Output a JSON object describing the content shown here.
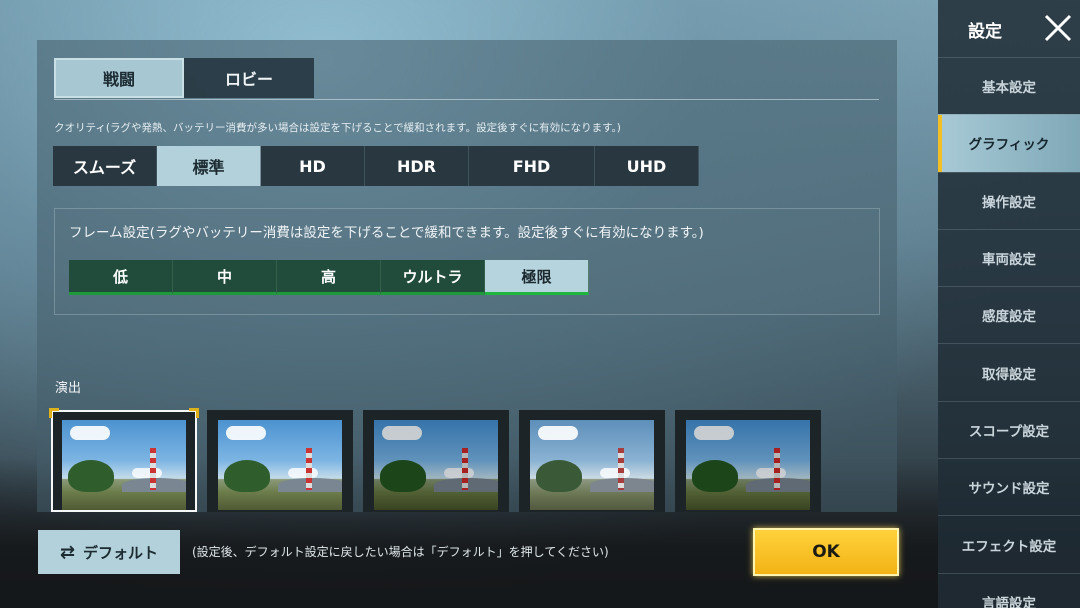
{
  "mode_tabs": [
    {
      "label": "戦闘",
      "active": true
    },
    {
      "label": "ロビー",
      "active": false
    }
  ],
  "quality": {
    "note": "クオリティ(ラグや発熱、バッテリー消費が多い場合は設定を下げることで緩和されます。設定後すぐに有効になります。)",
    "options": [
      "スムーズ",
      "標準",
      "HD",
      "HDR",
      "FHD",
      "UHD"
    ],
    "selected": "標準"
  },
  "frame": {
    "note": "フレーム設定(ラグやバッテリー消費は設定を下げることで緩和できます。設定後すぐに有効になります。)",
    "options": [
      "低",
      "中",
      "高",
      "ウルトラ",
      "極限"
    ],
    "selected": "極限"
  },
  "effects": {
    "label": "演出",
    "selected_index": 0,
    "count": 5
  },
  "bottom": {
    "default_label": "デフォルト",
    "default_note": "(設定後、デフォルト設定に戻したい場合は「デフォルト」を押してください)",
    "ok_label": "OK"
  },
  "sidebar": {
    "title": "設定",
    "items": [
      {
        "label": "基本設定"
      },
      {
        "label": "グラフィック"
      },
      {
        "label": "操作設定"
      },
      {
        "label": "車両設定"
      },
      {
        "label": "感度設定"
      },
      {
        "label": "取得設定"
      },
      {
        "label": "スコープ設定"
      },
      {
        "label": "サウンド設定"
      },
      {
        "label": "エフェクト設定"
      },
      {
        "label": "言語設定"
      }
    ],
    "active": "グラフィック"
  },
  "colors": {
    "accent_ok": "#f2b316",
    "selected_tab": "#b3d1da",
    "frame_green": "#1e9a3a"
  }
}
